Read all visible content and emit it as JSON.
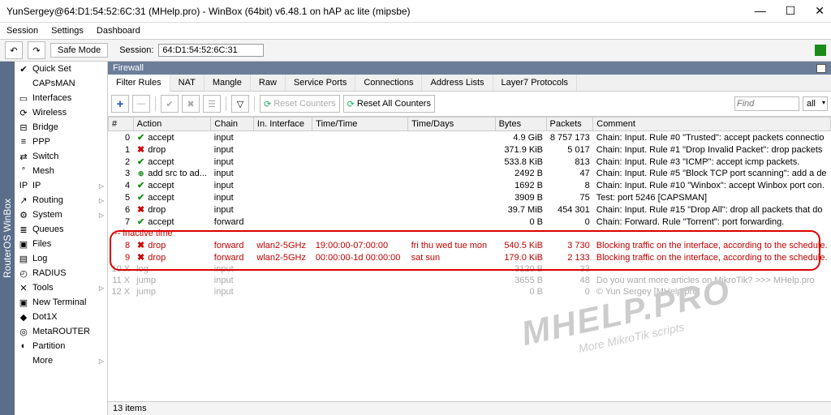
{
  "window": {
    "title": "YunSergey@64:D1:54:52:6C:31 (MHelp.pro) - WinBox (64bit) v6.48.1 on hAP ac lite (mipsbe)"
  },
  "menu": {
    "items": [
      "Session",
      "Settings",
      "Dashboard"
    ]
  },
  "toolbar": {
    "safe_mode": "Safe Mode",
    "session_label": "Session:",
    "session_value": "64:D1:54:52:6C:31"
  },
  "vtab": "RouterOS WinBox",
  "sidebar": {
    "items": [
      {
        "label": "Quick Set",
        "icon": "✔",
        "sub": false
      },
      {
        "label": "CAPsMAN",
        "icon": "",
        "sub": false
      },
      {
        "label": "Interfaces",
        "icon": "▭",
        "sub": false
      },
      {
        "label": "Wireless",
        "icon": "⟳",
        "sub": false
      },
      {
        "label": "Bridge",
        "icon": "⊟",
        "sub": false
      },
      {
        "label": "PPP",
        "icon": "≡",
        "sub": false
      },
      {
        "label": "Switch",
        "icon": "⇄",
        "sub": false
      },
      {
        "label": "Mesh",
        "icon": "°",
        "sub": false
      },
      {
        "label": "IP",
        "icon": "IP",
        "sub": true
      },
      {
        "label": "Routing",
        "icon": "↗",
        "sub": true
      },
      {
        "label": "System",
        "icon": "⚙",
        "sub": true
      },
      {
        "label": "Queues",
        "icon": "≣",
        "sub": false
      },
      {
        "label": "Files",
        "icon": "▣",
        "sub": false
      },
      {
        "label": "Log",
        "icon": "▤",
        "sub": false
      },
      {
        "label": "RADIUS",
        "icon": "◴",
        "sub": false
      },
      {
        "label": "Tools",
        "icon": "✕",
        "sub": true
      },
      {
        "label": "New Terminal",
        "icon": "▣",
        "sub": false
      },
      {
        "label": "Dot1X",
        "icon": "◆",
        "sub": false
      },
      {
        "label": "MetaROUTER",
        "icon": "◎",
        "sub": false
      },
      {
        "label": "Partition",
        "icon": "◐",
        "sub": false
      },
      {
        "label": "More",
        "icon": "",
        "sub": true
      }
    ]
  },
  "firewall": {
    "title": "Firewall",
    "tabs": [
      "Filter Rules",
      "NAT",
      "Mangle",
      "Raw",
      "Service Ports",
      "Connections",
      "Address Lists",
      "Layer7 Protocols"
    ],
    "active_tab": 0,
    "buttons": {
      "reset": "Reset Counters",
      "reset_all": "Reset All Counters"
    },
    "find_placeholder": "Find",
    "filter_all": "all",
    "columns": [
      "#",
      "Action",
      "Chain",
      "In. Interface",
      "Time/Time",
      "Time/Days",
      "Bytes",
      "Packets",
      "Comment"
    ],
    "section_label": "--- inactive time",
    "rows": [
      {
        "idx": "0",
        "action": "accept",
        "ico": "ok",
        "chain": "input",
        "if": "",
        "time": "",
        "days": "",
        "bytes": "4.9 GiB",
        "pkts": "8 757 173",
        "comment": "Chain: Input. Rule #0 \"Trusted\": accept packets connectio",
        "cls": ""
      },
      {
        "idx": "1",
        "action": "drop",
        "ico": "x",
        "chain": "input",
        "if": "",
        "time": "",
        "days": "",
        "bytes": "371.9 KiB",
        "pkts": "5 017",
        "comment": "Chain: Input. Rule #1 \"Drop Invalid Packet\": drop packets",
        "cls": ""
      },
      {
        "idx": "2",
        "action": "accept",
        "ico": "ok",
        "chain": "input",
        "if": "",
        "time": "",
        "days": "",
        "bytes": "533.8 KiB",
        "pkts": "813",
        "comment": "Chain: Input. Rule #3 \"ICMP\": accept icmp packets.",
        "cls": ""
      },
      {
        "idx": "3",
        "action": "add src to ad...",
        "ico": "add",
        "chain": "input",
        "if": "",
        "time": "",
        "days": "",
        "bytes": "2492 B",
        "pkts": "47",
        "comment": "Chain: Input. Rule #5 \"Block TCP port scanning\": add a de",
        "cls": ""
      },
      {
        "idx": "4",
        "action": "accept",
        "ico": "ok",
        "chain": "input",
        "if": "",
        "time": "",
        "days": "",
        "bytes": "1692 B",
        "pkts": "8",
        "comment": "Chain: Input. Rule #10 \"Winbox\": accept Winbox port con.",
        "cls": ""
      },
      {
        "idx": "5",
        "action": "accept",
        "ico": "ok",
        "chain": "input",
        "if": "",
        "time": "",
        "days": "",
        "bytes": "3909 B",
        "pkts": "75",
        "comment": "Test: port 5246 [CAPSMAN]",
        "cls": ""
      },
      {
        "idx": "6",
        "action": "drop",
        "ico": "x",
        "chain": "input",
        "if": "",
        "time": "",
        "days": "",
        "bytes": "39.7 MiB",
        "pkts": "454 301",
        "comment": "Chain: Input. Rule #15 \"Drop All\": drop all packets that do",
        "cls": ""
      },
      {
        "idx": "7",
        "action": "accept",
        "ico": "ok",
        "chain": "forward",
        "if": "",
        "time": "",
        "days": "",
        "bytes": "0 B",
        "pkts": "0",
        "comment": "Chain: Forward. Rule \"Torrent\": port forwarding.",
        "cls": ""
      },
      {
        "idx": "8",
        "action": "drop",
        "ico": "x",
        "chain": "forward",
        "if": "wlan2-5GHz",
        "time": "19:00:00-07:00:00",
        "days": "fri thu wed tue mon",
        "bytes": "540.5 KiB",
        "pkts": "3 730",
        "comment": "Blocking traffic on the interface, according to the schedule.",
        "cls": "red"
      },
      {
        "idx": "9",
        "action": "drop",
        "ico": "x",
        "chain": "forward",
        "if": "wlan2-5GHz",
        "time": "00:00:00-1d 00:00:00",
        "days": "sat sun",
        "bytes": "179.0 KiB",
        "pkts": "2 133",
        "comment": "Blocking traffic on the interface, according to the schedule.",
        "cls": "red"
      },
      {
        "idx": "10 X",
        "action": "log",
        "ico": "",
        "chain": "input",
        "if": "",
        "time": "",
        "days": "",
        "bytes": "3120 B",
        "pkts": "33",
        "comment": "",
        "cls": "dis"
      },
      {
        "idx": "11 X",
        "action": "jump",
        "ico": "",
        "chain": "input",
        "if": "",
        "time": "",
        "days": "",
        "bytes": "3655 B",
        "pkts": "48",
        "comment": "Do you want more articles on MikroTik? >>> MHelp.pro",
        "cls": "dis"
      },
      {
        "idx": "12 X",
        "action": "jump",
        "ico": "",
        "chain": "input",
        "if": "",
        "time": "",
        "days": "",
        "bytes": "0 B",
        "pkts": "0",
        "comment": "© Yun Sergey [MHelp.pro]",
        "cls": "dis"
      }
    ],
    "status": "13 items"
  },
  "watermark": {
    "big": "MHELP.PRO",
    "small": "More MikroTik scripts"
  }
}
